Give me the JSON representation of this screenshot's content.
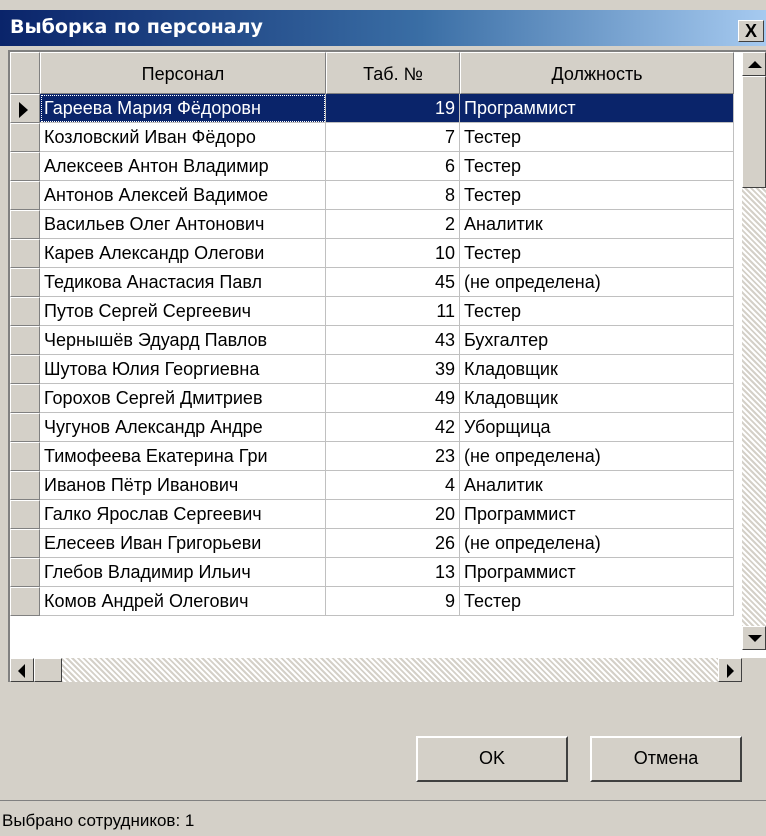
{
  "window": {
    "title": "Выборка по персоналу",
    "close_glyph": "X"
  },
  "grid": {
    "columns": [
      "Персонал",
      "Таб. №",
      "Должность"
    ],
    "selected_index": 0,
    "rows": [
      {
        "name": "Гареева Мария Фёдоровн",
        "num": "19",
        "position": "Программист"
      },
      {
        "name": "Козловский Иван Фёдоро",
        "num": "7",
        "position": "Тестер"
      },
      {
        "name": "Алексеев Антон Владимир",
        "num": "6",
        "position": "Тестер"
      },
      {
        "name": "Антонов Алексей Вадимое",
        "num": "8",
        "position": "Тестер"
      },
      {
        "name": "Васильев Олег Антонович",
        "num": "2",
        "position": "Аналитик"
      },
      {
        "name": "Карев Александр Олегови",
        "num": "10",
        "position": "Тестер"
      },
      {
        "name": "Тедикова Анастасия Павл",
        "num": "45",
        "position": "(не определена)"
      },
      {
        "name": "Путов Сергей Сергеевич",
        "num": "11",
        "position": "Тестер"
      },
      {
        "name": "Чернышёв Эдуард Павлов",
        "num": "43",
        "position": "Бухгалтер"
      },
      {
        "name": "Шутова Юлия Георгиевна",
        "num": "39",
        "position": "Кладовщик"
      },
      {
        "name": "Горохов Сергей Дмитриев",
        "num": "49",
        "position": "Кладовщик"
      },
      {
        "name": "Чугунов Александр Андре",
        "num": "42",
        "position": "Уборщица"
      },
      {
        "name": "Тимофеева Екатерина Гри",
        "num": "23",
        "position": "(не определена)"
      },
      {
        "name": "Иванов Пётр Иванович",
        "num": "4",
        "position": "Аналитик"
      },
      {
        "name": "Галко Ярослав Сергеевич",
        "num": "20",
        "position": "Программист"
      },
      {
        "name": "Елесеев Иван Григорьеви",
        "num": "26",
        "position": "(не определена)"
      },
      {
        "name": "Глебов Владимир Ильич",
        "num": "13",
        "position": "Программист"
      },
      {
        "name": "Комов Андрей Олегович",
        "num": "9",
        "position": "Тестер"
      }
    ]
  },
  "buttons": {
    "ok_label": "OK",
    "cancel_label": "Отмена"
  },
  "status": {
    "text": "Выбрано сотрудников: 1"
  },
  "colors": {
    "selection": "#0a246a",
    "title_start": "#0a246a",
    "title_end": "#a6caf0",
    "face": "#d4d0c8"
  },
  "icons": {
    "close": "close-icon",
    "row_pointer": "row-pointer-icon",
    "scroll_up": "scroll-up-icon",
    "scroll_down": "scroll-down-icon",
    "scroll_left": "scroll-left-icon",
    "scroll_right": "scroll-right-icon"
  }
}
